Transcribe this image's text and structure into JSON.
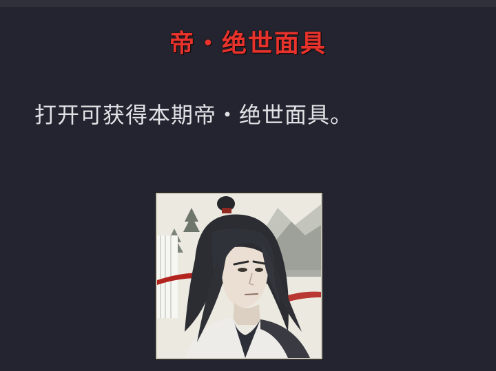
{
  "item": {
    "title": "帝・绝世面具",
    "description": "打开可获得本期帝・绝世面具。"
  },
  "portrait": {
    "icon": "character-portrait-icon"
  },
  "colors": {
    "background": "#23242f",
    "title": "#e8322c",
    "description": "#e2e2e6"
  }
}
